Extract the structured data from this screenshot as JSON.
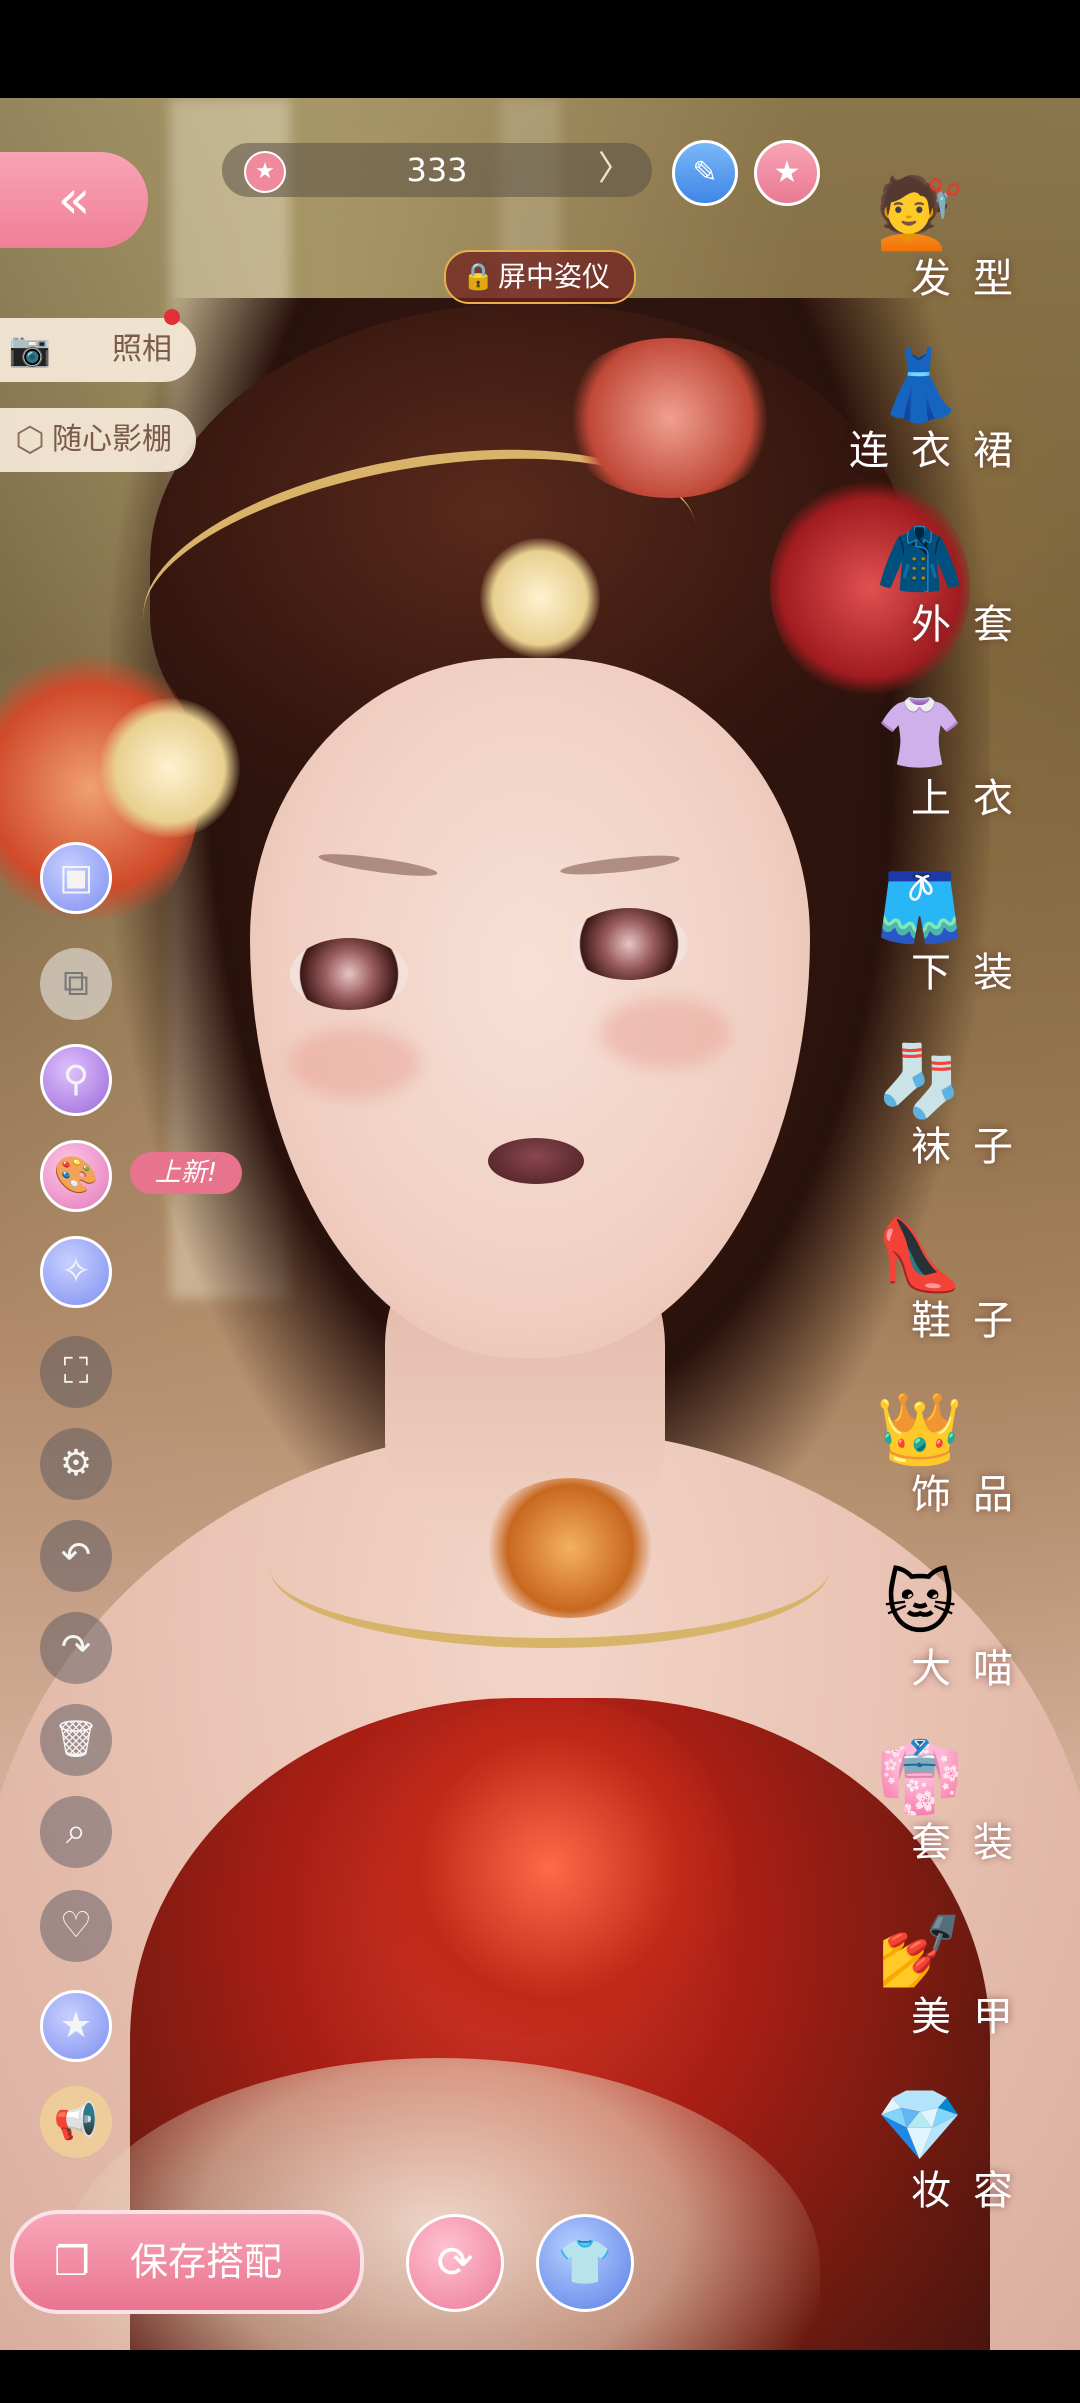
{
  "header": {
    "currency_value": "333",
    "star_icon": "★",
    "arrow_icon": "〉",
    "pencil_icon": "✎",
    "pose_lock_icon": "🔒",
    "pose_label": "屏中姿仪"
  },
  "left_top": {
    "back_icon": "«",
    "photo_label": "照相",
    "photo_icon": "📷",
    "studio_label": "随心影棚",
    "studio_icon": "⬡"
  },
  "tools": {
    "color_icon": "▣",
    "copy_icon": "⧉",
    "magic_icon": "⚲",
    "palette_icon": "🎨",
    "new_badge": "上新!",
    "star_icon": "✧",
    "fullscreen_icon": "⛶",
    "settings_icon": "⚙",
    "undo_icon": "↶",
    "redo_icon": "↷",
    "delete_icon": "🗑",
    "zoom_icon": "⌕",
    "heart_icon": "♡",
    "favorite_icon": "★",
    "announce_icon": "📢"
  },
  "categories": [
    {
      "label": "发型",
      "icon": "💇"
    },
    {
      "label": "连衣裙",
      "icon": "👗"
    },
    {
      "label": "外套",
      "icon": "🧥"
    },
    {
      "label": "上衣",
      "icon": "👚"
    },
    {
      "label": "下装",
      "icon": "🩳"
    },
    {
      "label": "袜子",
      "icon": "🧦"
    },
    {
      "label": "鞋子",
      "icon": "👠"
    },
    {
      "label": "饰品",
      "icon": "👑"
    },
    {
      "label": "大喵",
      "icon": "🐱"
    },
    {
      "label": "套装",
      "icon": "👘"
    },
    {
      "label": "美甲",
      "icon": "💅"
    },
    {
      "label": "妆容",
      "icon": "💎"
    }
  ],
  "bottom": {
    "save_label": "保存搭配",
    "save_icon": "❐",
    "swap_icon": "⟳",
    "outfit_icon": "👕"
  },
  "colors": {
    "pink_accent": "#ef7f97",
    "gold_accent": "#d9b36a"
  }
}
